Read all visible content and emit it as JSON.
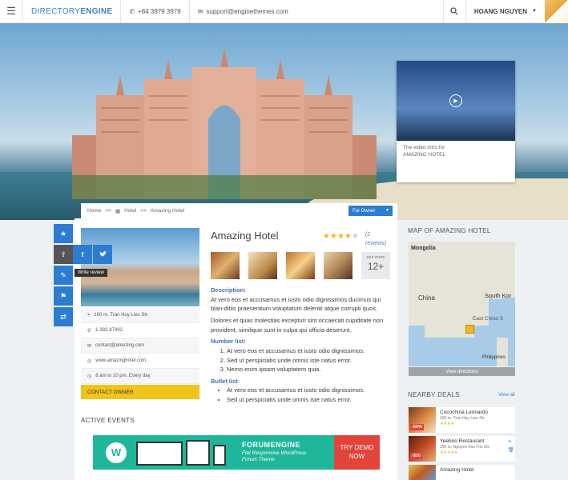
{
  "header": {
    "logo_part1": "DIRECTORY",
    "logo_part2": "ENGINE",
    "phone": "+84 3979 3979",
    "email": "support@enginethemes.com",
    "user_name": "HOANG NGUYEN"
  },
  "hero": {
    "video_caption_line1": "The video intro for",
    "video_caption_line2": "AMAZING HOTEL"
  },
  "breadcrumb": {
    "home": "Home",
    "sep1": ">>",
    "category": "Hotel",
    "sep2": ">>",
    "current": "Amazing Hotel",
    "owner_button": "For Owner"
  },
  "side_actions": {
    "write_review_tooltip": "Write review",
    "share_facebook": "f"
  },
  "listing": {
    "title": "Amazing Hotel",
    "rating": 4,
    "rating_max": 5,
    "reviews_link": "(2 reviews)",
    "see_more_label": "see more",
    "see_more_count": "12+",
    "address": "100 m. Tran Huy Lieu Str.",
    "phone": "1-382-87492",
    "email": "contact@amezing.com",
    "website": "www.amazinghotel.com",
    "hours": "8 am to 10 pm. Every day",
    "contact_owner": "CONTACT OWNER",
    "description_label": "Description:",
    "description_p1": "At vero eos et accusamus et iusto odio dignissimos ducimus qui blan-ditiis praesentium voluptatum deleniti atque corrupti quos.",
    "description_p2": "Dolores et quas molestias excepturi sint occaecati cupiditate non provident, similique sunt in culpa qui officia deserunt.",
    "number_list_label": "Number list:",
    "number_list": [
      "At vero eos et accusamus et iusto odio dignissimos.",
      "Sed ut perspiciatis unde omnis iste natus error.",
      "Nemo enim ipsam voluptatem quia."
    ],
    "bullet_list_label": "Bullet list:",
    "bullet_list": [
      "At vero eos et accusamus et iusto odio dignissimos.",
      "Sed ut perspiciatis unde omnis iste natus error."
    ]
  },
  "events": {
    "heading": "ACTIVE EVENTS",
    "banner_title": "FORUMENGINE",
    "banner_line1": "Flat Responsive WordPress",
    "banner_line2": "Forum Theme",
    "banner_cta_line1": "TRY DEMO",
    "banner_cta_line2": "NOW",
    "wp_letter": "W"
  },
  "map": {
    "title": "MAP OF AMAZING HOTEL",
    "label_mongolia": "Mongolia",
    "label_china": "China",
    "label_south_korea": "South Kor",
    "label_east_china_sea": "East China S",
    "label_philippines": "Philippines",
    "view_directions": "View directions"
  },
  "deals": {
    "title": "NEARBY DEALS",
    "view_all": "View all",
    "items": [
      {
        "name": "Cocochina Leonardo",
        "address": "100 m. Tran Huy Lieu Str.",
        "badge": "-50%"
      },
      {
        "name": "Yeeboo Restaurant",
        "address": "250 m. Nguyen Van Troi Str.",
        "badge": "-$30"
      },
      {
        "name": "Amazing Hotel",
        "address": "",
        "badge": ""
      }
    ]
  },
  "colors": {
    "accent": "#2c7dd1",
    "contact_owner": "#f0c419",
    "banner": "#1fb799",
    "cta": "#e2433b",
    "star": "#f0b61c"
  }
}
